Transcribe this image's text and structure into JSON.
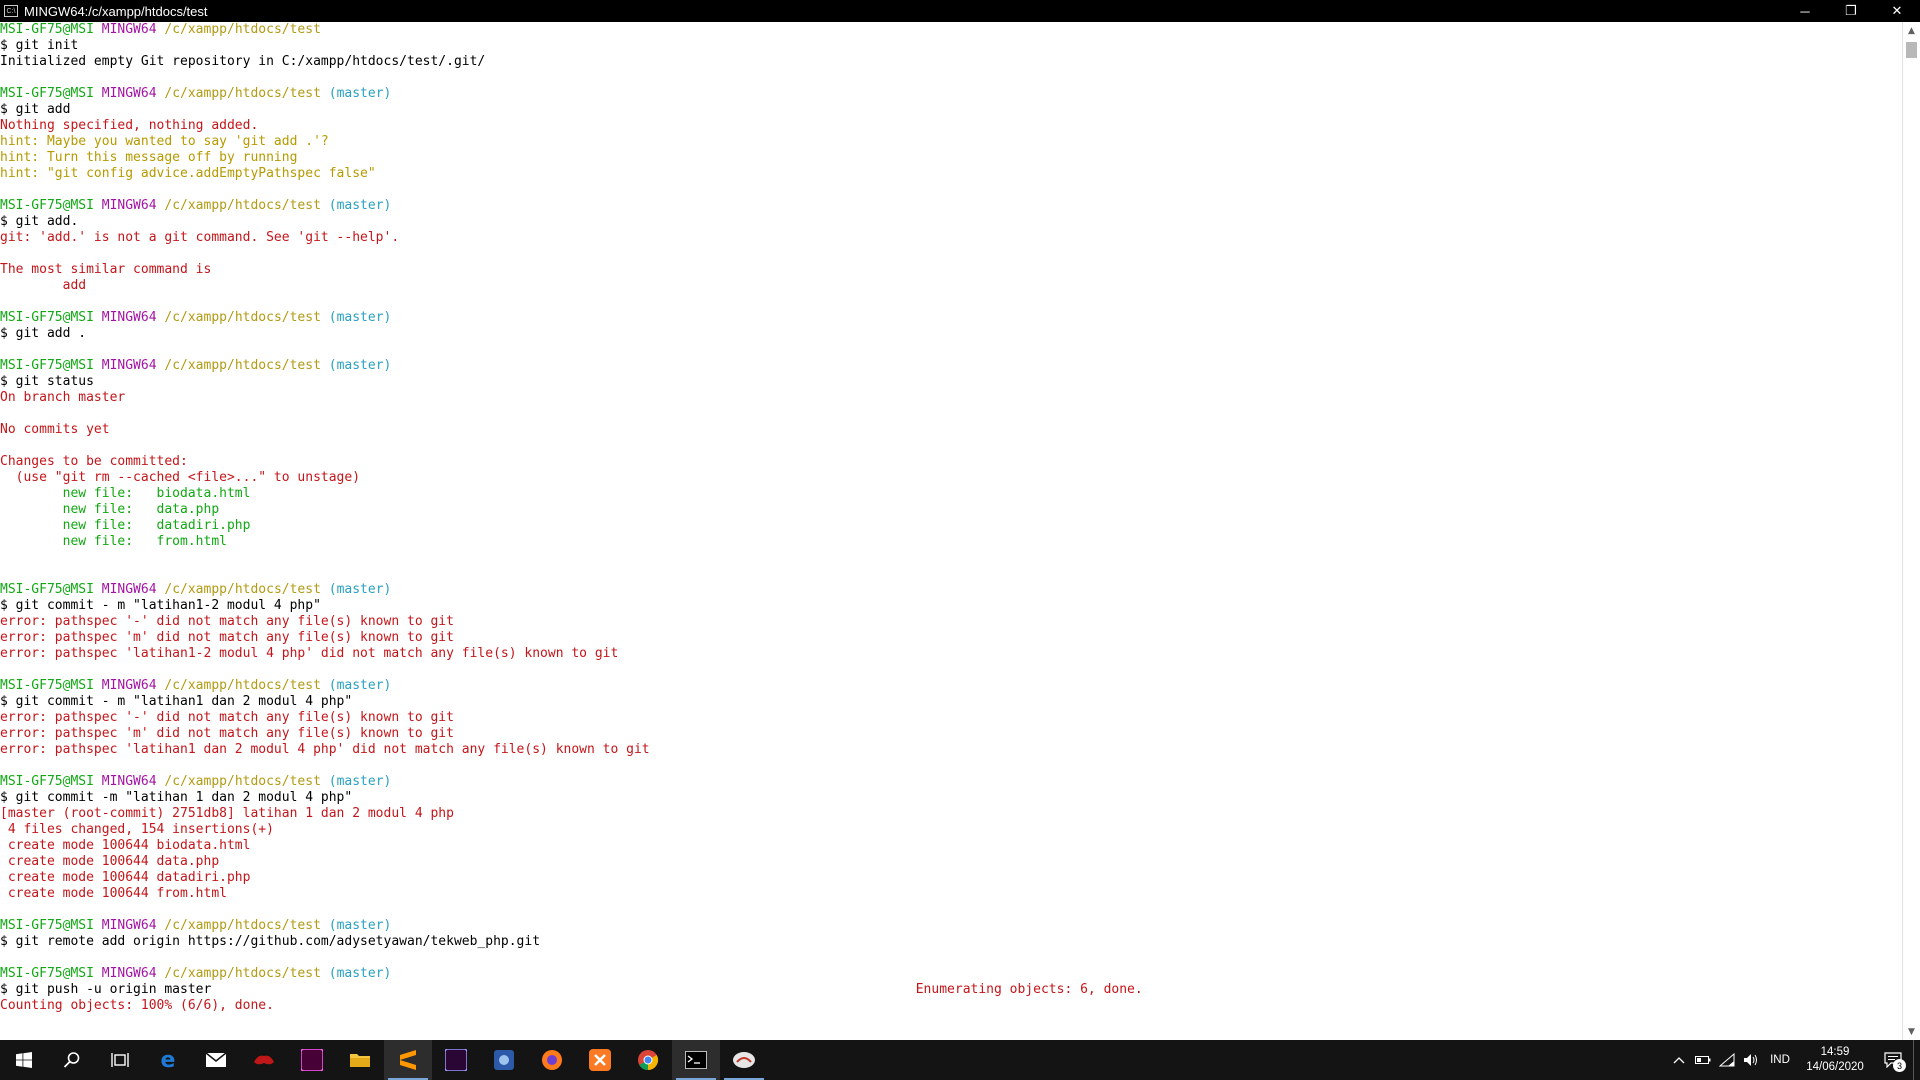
{
  "window": {
    "title": "MINGW64:/c/xampp/htdocs/test",
    "minimize": "─",
    "restore": "❐",
    "close": "✕"
  },
  "terminal": {
    "lines": [
      [
        {
          "t": "MSI-GF75@MSI ",
          "c": "green"
        },
        {
          "t": "MINGW64 ",
          "c": "purple"
        },
        {
          "t": "/c/xampp/htdocs/test",
          "c": "yellow"
        }
      ],
      [
        {
          "t": "$ git init",
          "c": "black"
        }
      ],
      [
        {
          "t": "Initialized empty Git repository in C:/xampp/htdocs/test/.git/",
          "c": "black"
        }
      ],
      [],
      [
        {
          "t": "MSI-GF75@MSI ",
          "c": "green"
        },
        {
          "t": "MINGW64 ",
          "c": "purple"
        },
        {
          "t": "/c/xampp/htdocs/test ",
          "c": "yellow"
        },
        {
          "t": "(master)",
          "c": "cyan"
        }
      ],
      [
        {
          "t": "$ git add",
          "c": "black"
        }
      ],
      [
        {
          "t": "Nothing specified, nothing added.",
          "c": "red"
        }
      ],
      [
        {
          "t": "hint: Maybe you wanted to say 'git add .'?",
          "c": "hint"
        }
      ],
      [
        {
          "t": "hint: Turn this message off by running",
          "c": "hint"
        }
      ],
      [
        {
          "t": "hint: \"git config advice.addEmptyPathspec false\"",
          "c": "hint"
        }
      ],
      [],
      [
        {
          "t": "MSI-GF75@MSI ",
          "c": "green"
        },
        {
          "t": "MINGW64 ",
          "c": "purple"
        },
        {
          "t": "/c/xampp/htdocs/test ",
          "c": "yellow"
        },
        {
          "t": "(master)",
          "c": "cyan"
        }
      ],
      [
        {
          "t": "$ git add.",
          "c": "black"
        }
      ],
      [
        {
          "t": "git: 'add.' is not a git command. See 'git --help'.",
          "c": "red"
        }
      ],
      [],
      [
        {
          "t": "The most similar command is",
          "c": "red"
        }
      ],
      [
        {
          "t": "        add",
          "c": "red"
        }
      ],
      [],
      [
        {
          "t": "MSI-GF75@MSI ",
          "c": "green"
        },
        {
          "t": "MINGW64 ",
          "c": "purple"
        },
        {
          "t": "/c/xampp/htdocs/test ",
          "c": "yellow"
        },
        {
          "t": "(master)",
          "c": "cyan"
        }
      ],
      [
        {
          "t": "$ git add .",
          "c": "black"
        }
      ],
      [],
      [
        {
          "t": "MSI-GF75@MSI ",
          "c": "green"
        },
        {
          "t": "MINGW64 ",
          "c": "purple"
        },
        {
          "t": "/c/xampp/htdocs/test ",
          "c": "yellow"
        },
        {
          "t": "(master)",
          "c": "cyan"
        }
      ],
      [
        {
          "t": "$ git status",
          "c": "black"
        }
      ],
      [
        {
          "t": "On branch master",
          "c": "red"
        }
      ],
      [],
      [
        {
          "t": "No commits yet",
          "c": "red"
        }
      ],
      [],
      [
        {
          "t": "Changes to be committed:",
          "c": "red"
        }
      ],
      [
        {
          "t": "  (use \"git rm --cached <file>...\" to unstage)",
          "c": "red"
        }
      ],
      [
        {
          "t": "        new file:   biodata.html",
          "c": "green"
        }
      ],
      [
        {
          "t": "        new file:   data.php",
          "c": "green"
        }
      ],
      [
        {
          "t": "        new file:   datadiri.php",
          "c": "green"
        }
      ],
      [
        {
          "t": "        new file:   from.html",
          "c": "green"
        }
      ],
      [],
      [],
      [
        {
          "t": "MSI-GF75@MSI ",
          "c": "green"
        },
        {
          "t": "MINGW64 ",
          "c": "purple"
        },
        {
          "t": "/c/xampp/htdocs/test ",
          "c": "yellow"
        },
        {
          "t": "(master)",
          "c": "cyan"
        }
      ],
      [
        {
          "t": "$ git commit - m \"latihan1-2 modul 4 php\"",
          "c": "black"
        }
      ],
      [
        {
          "t": "error: pathspec '-' did not match any file(s) known to git",
          "c": "red"
        }
      ],
      [
        {
          "t": "error: pathspec 'm' did not match any file(s) known to git",
          "c": "red"
        }
      ],
      [
        {
          "t": "error: pathspec 'latihan1-2 modul 4 php' did not match any file(s) known to git",
          "c": "red"
        }
      ],
      [],
      [
        {
          "t": "MSI-GF75@MSI ",
          "c": "green"
        },
        {
          "t": "MINGW64 ",
          "c": "purple"
        },
        {
          "t": "/c/xampp/htdocs/test ",
          "c": "yellow"
        },
        {
          "t": "(master)",
          "c": "cyan"
        }
      ],
      [
        {
          "t": "$ git commit - m \"latihan1 dan 2 modul 4 php\"",
          "c": "black"
        }
      ],
      [
        {
          "t": "error: pathspec '-' did not match any file(s) known to git",
          "c": "red"
        }
      ],
      [
        {
          "t": "error: pathspec 'm' did not match any file(s) known to git",
          "c": "red"
        }
      ],
      [
        {
          "t": "error: pathspec 'latihan1 dan 2 modul 4 php' did not match any file(s) known to git",
          "c": "red"
        }
      ],
      [],
      [
        {
          "t": "MSI-GF75@MSI ",
          "c": "green"
        },
        {
          "t": "MINGW64 ",
          "c": "purple"
        },
        {
          "t": "/c/xampp/htdocs/test ",
          "c": "yellow"
        },
        {
          "t": "(master)",
          "c": "cyan"
        }
      ],
      [
        {
          "t": "$ git commit -m \"latihan 1 dan 2 modul 4 php\"",
          "c": "black"
        }
      ],
      [
        {
          "t": "[master (root-commit) 2751db8] latihan 1 dan 2 modul 4 php",
          "c": "red"
        }
      ],
      [
        {
          "t": " 4 files changed, 154 insertions(+)",
          "c": "red"
        }
      ],
      [
        {
          "t": " create mode 100644 biodata.html",
          "c": "red"
        }
      ],
      [
        {
          "t": " create mode 100644 data.php",
          "c": "red"
        }
      ],
      [
        {
          "t": " create mode 100644 datadiri.php",
          "c": "red"
        }
      ],
      [
        {
          "t": " create mode 100644 from.html",
          "c": "red"
        }
      ],
      [],
      [
        {
          "t": "MSI-GF75@MSI ",
          "c": "green"
        },
        {
          "t": "MINGW64 ",
          "c": "purple"
        },
        {
          "t": "/c/xampp/htdocs/test ",
          "c": "yellow"
        },
        {
          "t": "(master)",
          "c": "cyan"
        }
      ],
      [
        {
          "t": "$ git remote add origin https://github.com/adysetyawan/tekweb_php.git",
          "c": "black"
        }
      ],
      [],
      [
        {
          "t": "MSI-GF75@MSI ",
          "c": "green"
        },
        {
          "t": "MINGW64 ",
          "c": "purple"
        },
        {
          "t": "/c/xampp/htdocs/test ",
          "c": "yellow"
        },
        {
          "t": "(master)",
          "c": "cyan"
        }
      ],
      [
        {
          "t": "$ git push -u origin master                                                                                          ",
          "c": "black"
        },
        {
          "t": "Enumerating objects: 6, done.",
          "c": "red"
        }
      ],
      [
        {
          "t": "Counting objects: 100% (6/6), done.",
          "c": "red"
        }
      ]
    ]
  },
  "scrollbar": {
    "up_arrow": "▲",
    "down_arrow": "▼"
  },
  "taskbar": {
    "apps": [
      {
        "name": "start-button",
        "icon": "windows-logo-icon"
      },
      {
        "name": "search-button",
        "icon": "search-icon"
      },
      {
        "name": "task-view-button",
        "icon": "task-view-icon"
      },
      {
        "name": "taskbar-edge",
        "icon": "edge-icon"
      },
      {
        "name": "taskbar-mail",
        "icon": "mail-icon"
      },
      {
        "name": "taskbar-game-app",
        "icon": "gaming-app-icon"
      },
      {
        "name": "taskbar-adobe-xd",
        "icon": "adobe-xd-icon",
        "label": "Xd"
      },
      {
        "name": "taskbar-file-explorer",
        "icon": "folder-icon"
      },
      {
        "name": "taskbar-sublime-text",
        "icon": "sublime-text-icon"
      },
      {
        "name": "taskbar-premiere-pro",
        "icon": "premiere-pro-icon",
        "label": "Pr"
      },
      {
        "name": "taskbar-app-blue",
        "icon": "app-icon"
      },
      {
        "name": "taskbar-firefox",
        "icon": "firefox-icon"
      },
      {
        "name": "taskbar-xampp",
        "icon": "xampp-icon"
      },
      {
        "name": "taskbar-chrome",
        "icon": "chrome-icon"
      },
      {
        "name": "taskbar-terminal",
        "icon": "terminal-icon"
      },
      {
        "name": "taskbar-app-white",
        "icon": "app-icon"
      }
    ],
    "tray": {
      "language": "IND",
      "time": "14:59",
      "date": "14/06/2020",
      "notification_count": "3"
    }
  }
}
